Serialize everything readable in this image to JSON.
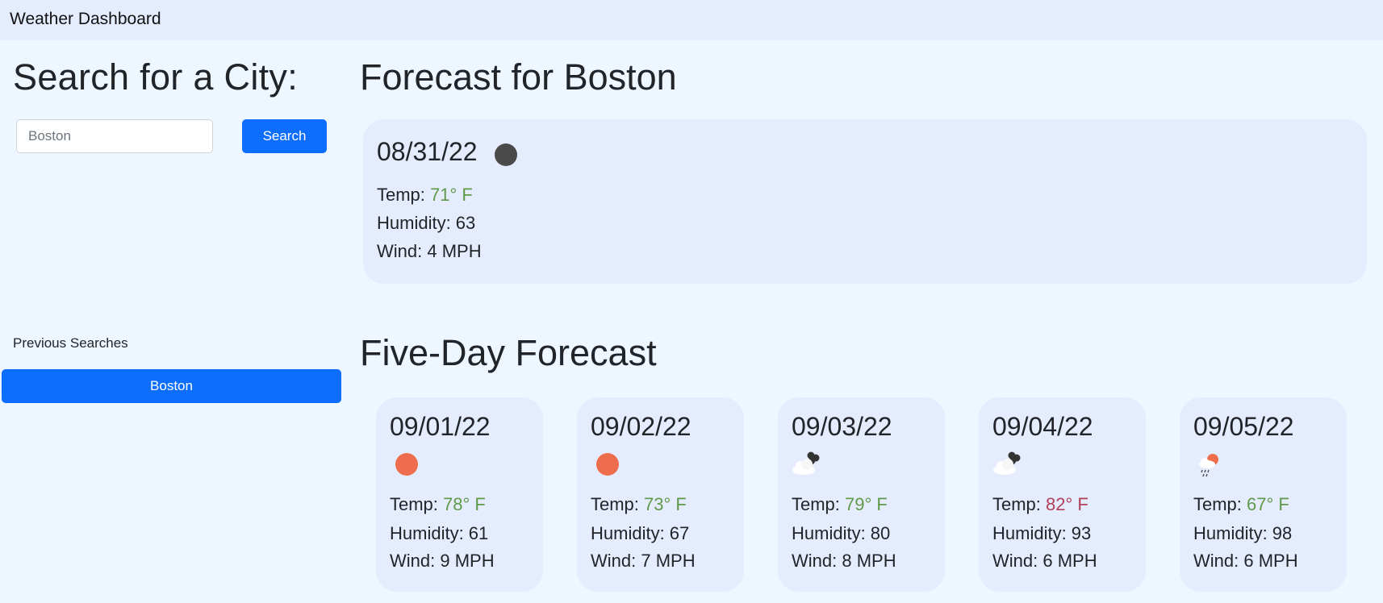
{
  "navbar": {
    "brand": "Weather Dashboard"
  },
  "search": {
    "heading": "Search for a City:",
    "placeholder": "Boston",
    "value": "",
    "button_label": "Search"
  },
  "history": {
    "label": "Previous Searches",
    "items": [
      "Boston"
    ]
  },
  "current": {
    "heading": "Forecast for Boston",
    "date": "08/31/22",
    "icon": "moon-icon",
    "temp_label": "Temp: ",
    "temp_value": "71° F",
    "humidity": "Humidity: 63",
    "wind": "Wind: 4 MPH"
  },
  "five_day": {
    "heading": "Five-Day Forecast",
    "days": [
      {
        "date": "09/01/22",
        "icon": "sun-icon",
        "temp_label": "Temp: ",
        "temp_value": "78° F",
        "humidity": "Humidity: 61",
        "wind": "Wind: 9 MPH"
      },
      {
        "date": "09/02/22",
        "icon": "sun-icon",
        "temp_label": "Temp: ",
        "temp_value": "73° F",
        "humidity": "Humidity: 67",
        "wind": "Wind: 7 MPH"
      },
      {
        "date": "09/03/22",
        "icon": "cloudy-icon",
        "temp_label": "Temp: ",
        "temp_value": "79° F",
        "humidity": "Humidity: 80",
        "wind": "Wind: 8 MPH"
      },
      {
        "date": "09/04/22",
        "icon": "cloudy-icon",
        "temp_label": "Temp: ",
        "temp_value": "82° F",
        "humidity": "Humidity: 93",
        "wind": "Wind: 6 MPH"
      },
      {
        "date": "09/05/22",
        "icon": "rain-icon",
        "temp_label": "Temp: ",
        "temp_value": "67° F",
        "humidity": "Humidity: 98",
        "wind": "Wind: 6 MPH"
      }
    ]
  },
  "colors": {
    "navbar_bg": "#e5ecfd",
    "page_bg": "#eef6ff",
    "card_bg": "#e5ecfd",
    "primary_button": "#0d6efd",
    "temp_mild": "#5e9a4a",
    "temp_hot": "#b0415a",
    "sun": "#ee6d4c",
    "moon": "#4a4a4a"
  }
}
